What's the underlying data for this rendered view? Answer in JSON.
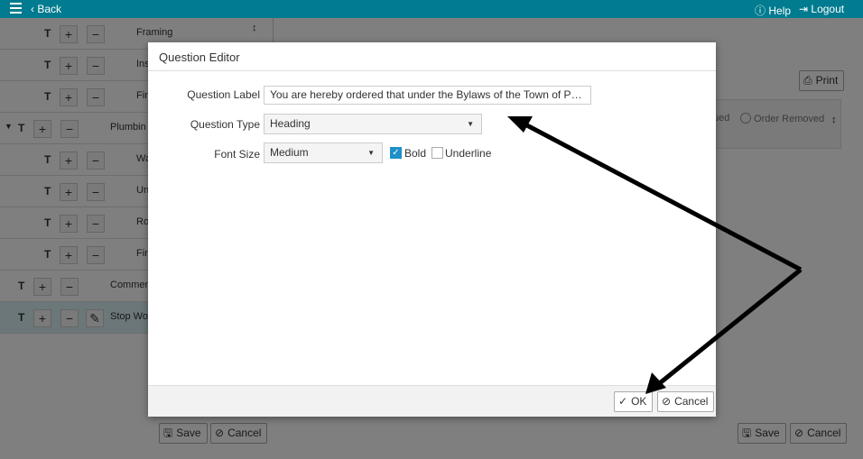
{
  "topbar": {
    "back_label": "Back",
    "help_label": "Help",
    "logout_label": "Logout"
  },
  "tree": {
    "rows": [
      {
        "label": "Framing",
        "indent": 1
      },
      {
        "label": "Ins",
        "indent": 1
      },
      {
        "label": "Fir",
        "indent": 1
      },
      {
        "label": "Plumbin",
        "indent": 0
      },
      {
        "label": "Wa",
        "indent": 1
      },
      {
        "label": "Un",
        "indent": 1
      },
      {
        "label": "Ro",
        "indent": 1
      },
      {
        "label": "Fir",
        "indent": 1
      },
      {
        "label": "Commen",
        "indent": 0
      },
      {
        "label": "Stop Wo",
        "indent": 0
      }
    ],
    "t_label": "T",
    "plus": "+",
    "minus": "−"
  },
  "left_footer": {
    "save_label": "Save",
    "cancel_label": "Cancel"
  },
  "right": {
    "print_label": "Print",
    "partial_status": "ued",
    "order_removed_label": "Order Removed",
    "save_label": "Save",
    "cancel_label": "Cancel"
  },
  "modal": {
    "title": "Question Editor",
    "question_label_label": "Question Label",
    "question_label_value": "You are hereby ordered that under the Bylaws of the Town of Perry Bay, al...",
    "question_type_label": "Question Type",
    "question_type_value": "Heading",
    "font_size_label": "Font Size",
    "font_size_value": "Medium",
    "bold_label": "Bold",
    "underline_label": "Underline",
    "ok_label": "OK",
    "cancel_label": "Cancel"
  }
}
